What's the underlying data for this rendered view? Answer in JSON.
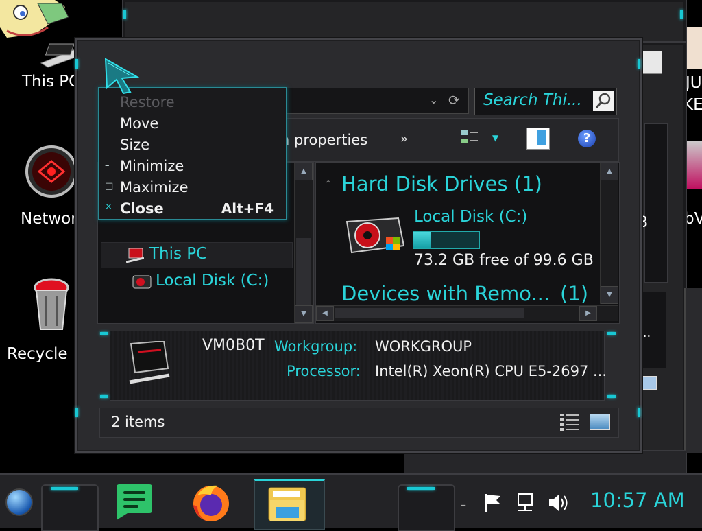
{
  "desktop": {
    "icons": [
      {
        "name": "this-pc",
        "label": "This PC"
      },
      {
        "name": "network",
        "label": "Networ"
      },
      {
        "name": "recycle-bin",
        "label": "Recycle B"
      }
    ],
    "right_labels": {
      "ju": "JU",
      "ke": "KE",
      "bv": "bV",
      "b": "B",
      "ell": "..."
    }
  },
  "address_bar": {
    "search_placeholder": "Search Thi..."
  },
  "toolbar": {
    "properties_label": "n properties",
    "more": "»"
  },
  "context_menu": {
    "items": [
      {
        "label": "Restore",
        "disabled": true,
        "icon": ""
      },
      {
        "label": "Move",
        "disabled": false,
        "icon": ""
      },
      {
        "label": "Size",
        "disabled": false,
        "icon": ""
      },
      {
        "label": "Minimize",
        "disabled": false,
        "icon": "–"
      },
      {
        "label": "Maximize",
        "disabled": false,
        "icon": "□"
      },
      {
        "label": "Close",
        "disabled": false,
        "icon": "×",
        "shortcut": "Alt+F4",
        "bold": true
      }
    ]
  },
  "nav_pane": {
    "items": [
      {
        "label": "This PC",
        "selected": true
      },
      {
        "label": "Local Disk (C:)",
        "selected": false
      }
    ]
  },
  "content": {
    "groups": [
      {
        "title": "Hard Disk Drives (1)"
      },
      {
        "title": "Devices with Remo...",
        "count": "(1)"
      }
    ],
    "drive": {
      "name": "Local Disk (C:)",
      "free_text": "73.2 GB free of 99.6 GB",
      "used_fraction": 0.265
    }
  },
  "details": {
    "computer_name": "VM0B0T",
    "workgroup_label": "Workgroup:",
    "workgroup_value": "WORKGROUP",
    "processor_label": "Processor:",
    "processor_value": "Intel(R) Xeon(R) CPU E5-2697 ..."
  },
  "status_bar": {
    "items_count": "2 items"
  },
  "taskbar": {
    "clock": "10:57 AM",
    "apps": [
      "start-orb",
      "speech-app",
      "firefox",
      "file-explorer"
    ]
  },
  "colors": {
    "accent": "#2ad4d9",
    "bg": "#000000",
    "window": "#2b2b2e",
    "pane": "#141416"
  }
}
